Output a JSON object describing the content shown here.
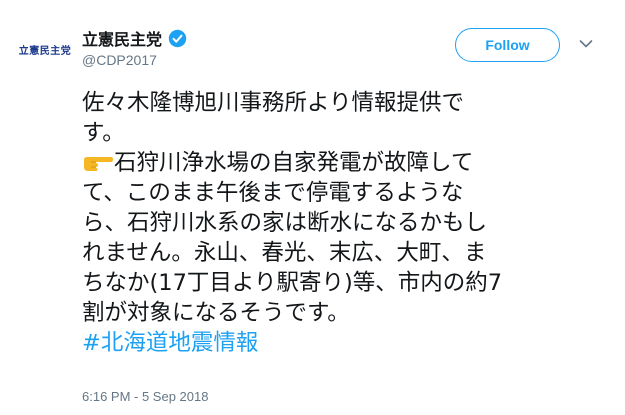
{
  "user": {
    "avatar_text": "立憲民主党",
    "display_name": "立憲民主党",
    "handle": "@CDP2017",
    "verified": true
  },
  "actions": {
    "follow_label": "Follow",
    "caret_icon": "chevron-down-icon"
  },
  "tweet": {
    "lines": [
      "佐々木隆博旭川事務所より情報提供で",
      "す。",
      "石狩川浄水場の自家発電が故障して",
      "て、このまま午後まで停電するような",
      "ら、石狩川水系の家は断水になるかもし",
      "れません。永山、春光、末広、大町、ま",
      "ちなか(17丁目より駅寄り)等、市内の約7",
      "割が対象になるそうです。"
    ],
    "emoji": "pointing-right-hand-icon",
    "hashtag": "#北海道地震情報"
  },
  "timestamp": "6:16 PM - 5 Sep 2018",
  "colors": {
    "accent": "#1da1f2",
    "text": "#14171a",
    "muted": "#657786",
    "logo_blue": "#1b3a8c"
  }
}
